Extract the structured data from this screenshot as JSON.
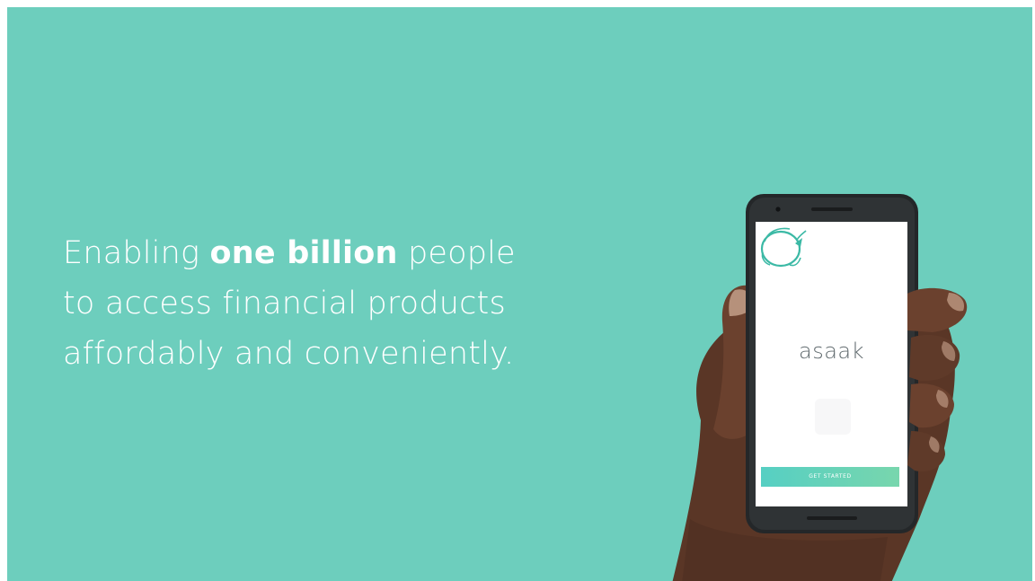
{
  "headline": {
    "before": "Enabling ",
    "emphasis": "one billion",
    "after_line1": " people",
    "line2": "to access financial products",
    "line3": "affordably and conveniently."
  },
  "phone": {
    "brand": "asaak",
    "logo_icon": "asaak-logo-icon",
    "cta_label": "GET STARTED"
  },
  "colors": {
    "background": "#6dcebd",
    "text": "#ffffff",
    "cta_gradient_start": "#56cfc3",
    "cta_gradient_end": "#78d6ad",
    "brand_text": "#606a6e"
  }
}
